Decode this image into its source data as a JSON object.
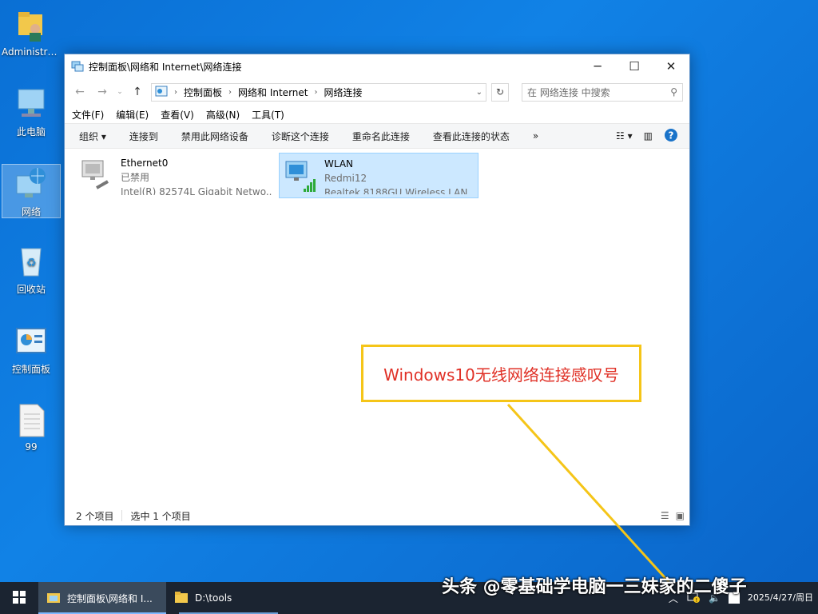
{
  "desktop": {
    "icons": [
      {
        "label": "Administra..."
      },
      {
        "label": "此电脑"
      },
      {
        "label": "网络"
      },
      {
        "label": "回收站"
      },
      {
        "label": "控制面板"
      },
      {
        "label": "99"
      }
    ]
  },
  "window": {
    "title": "控制面板\\网络和 Internet\\网络连接",
    "minimize": "─",
    "maximize": "☐",
    "close": "✕",
    "address": {
      "crumbs": [
        "控制面板",
        "网络和 Internet",
        "网络连接"
      ]
    },
    "search": {
      "placeholder": "在 网络连接 中搜索"
    },
    "menu": [
      "文件(F)",
      "编辑(E)",
      "查看(V)",
      "高级(N)",
      "工具(T)"
    ],
    "commands": [
      "组织 ▾",
      "连接到",
      "禁用此网络设备",
      "诊断这个连接",
      "重命名此连接",
      "查看此连接的状态",
      "»"
    ],
    "items": [
      {
        "name": "Ethernet0",
        "status": "已禁用",
        "device": "Intel(R) 82574L Gigabit Netwo..."
      },
      {
        "name": "WLAN",
        "status": "Redmi12",
        "device": "Realtek 8188GU Wireless LAN ..."
      }
    ],
    "status": {
      "count": "2 个项目",
      "selected": "选中 1 个项目"
    }
  },
  "annotation": {
    "text": "Windows10无线网络连接感叹号"
  },
  "taskbar": {
    "tasks": [
      {
        "label": "控制面板\\网络和 I..."
      },
      {
        "label": "D:\\tools"
      }
    ],
    "time": "",
    "date": "2025/4/27/周日"
  },
  "watermark": "头条 @零基础学电脑一三妹家的二傻子"
}
